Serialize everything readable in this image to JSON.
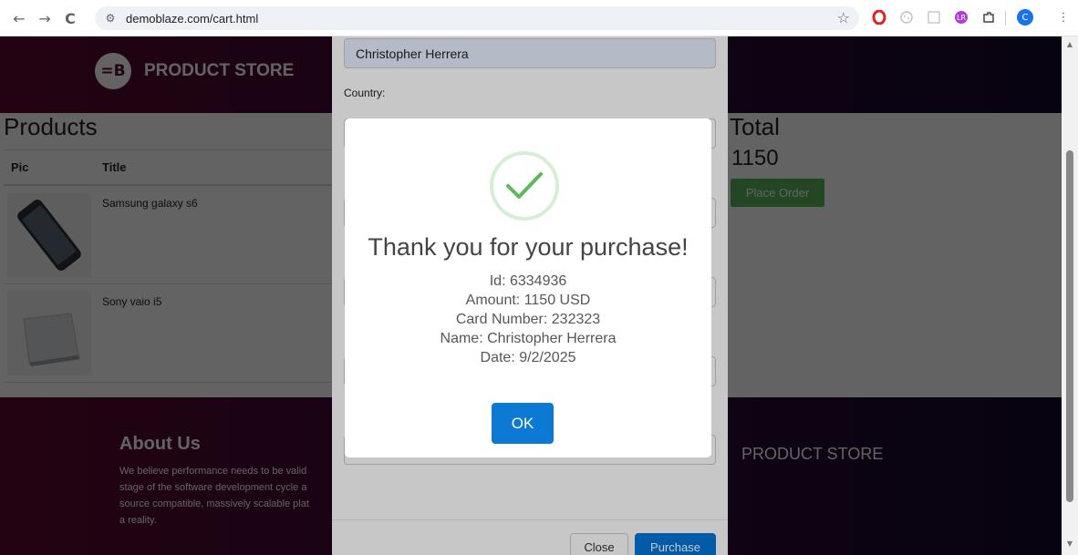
{
  "browser": {
    "back_icon": "←",
    "forward_icon": "→",
    "reload_icon": "C",
    "site_info_icon": "⚙",
    "url": "demoblaze.com/cart.html",
    "star_icon": "☆",
    "menu_icon": "⋮",
    "profile_initial": "C"
  },
  "navbar": {
    "logo_text": "=B",
    "brand": "PRODUCT STORE"
  },
  "cart": {
    "heading": "Products",
    "columns": [
      "Pic",
      "Title"
    ],
    "rows": [
      {
        "title": "Samsung galaxy s6"
      },
      {
        "title": "Sony vaio i5"
      }
    ],
    "total_heading": "Total",
    "total_value": "1150",
    "place_order_label": "Place Order"
  },
  "footer": {
    "about_heading": "About Us",
    "about_text": "We believe performance needs to be valid\nstage of the software development cycle a\nsource compatible, massively scalable plat\na reality.",
    "store_title": "PRODUCT STORE"
  },
  "order_modal": {
    "name_value": "Christopher Herrera",
    "country_label": "Country:",
    "close_label": "Close",
    "purchase_label": "Purchase"
  },
  "confirmation": {
    "title": "Thank you for your purchase!",
    "lines": [
      "Id: 6334936",
      "Amount: 1150 USD",
      "Card Number: 232323",
      "Name: Christopher Herrera",
      "Date: 9/2/2025"
    ],
    "ok_label": "OK",
    "check_color": "#5cb85c"
  }
}
